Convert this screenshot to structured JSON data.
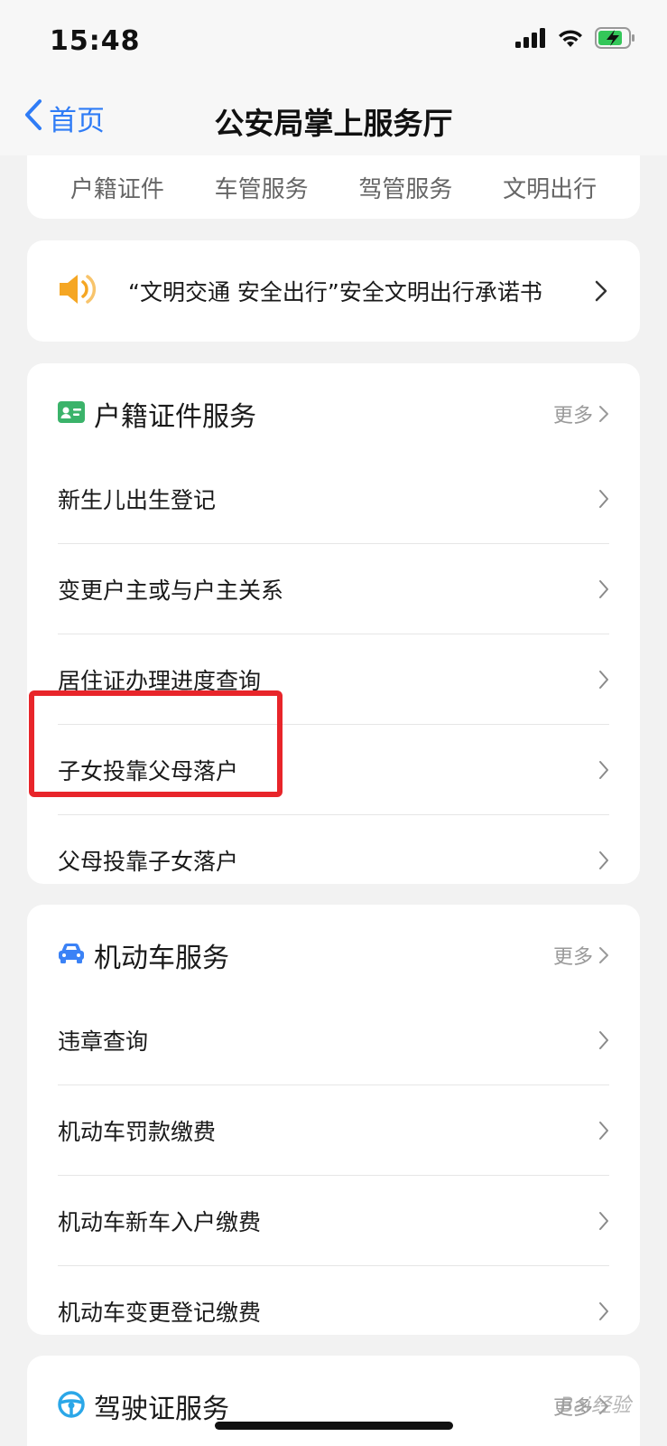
{
  "status_bar": {
    "time": "15:48",
    "icons": [
      "signal-icon",
      "wifi-icon",
      "battery-charging-icon"
    ]
  },
  "nav": {
    "back_label": "首页",
    "title": "公安局掌上服务厅"
  },
  "tabs": [
    {
      "label": "户籍证件"
    },
    {
      "label": "车管服务"
    },
    {
      "label": "驾管服务"
    },
    {
      "label": "文明出行"
    }
  ],
  "notice": {
    "icon": "speaker-icon",
    "text": "“文明交通 安全出行”安全文明出行承诺书"
  },
  "household": {
    "title": "户籍证件服务",
    "more": "更多",
    "items": [
      {
        "label": "新生儿出生登记"
      },
      {
        "label": "变更户主或与户主关系"
      },
      {
        "label": "居住证办理进度查询"
      },
      {
        "label": "子女投靠父母落户"
      },
      {
        "label": "父母投靠子女落户"
      }
    ]
  },
  "vehicle": {
    "title": "机动车服务",
    "more": "更多",
    "items": [
      {
        "label": "违章查询"
      },
      {
        "label": "机动车罚款缴费"
      },
      {
        "label": "机动车新车入户缴费"
      },
      {
        "label": "机动车变更登记缴费"
      }
    ]
  },
  "license": {
    "title": "驾驶证服务",
    "more": "更多"
  },
  "colors": {
    "accent": "#2f7cf6",
    "highlight": "#e8252a",
    "household_icon": "#3bb36a",
    "vehicle_icon": "#3b82f6",
    "license_icon": "#2ba7e8",
    "speaker": "#f5a623"
  },
  "watermark": "Bai经验"
}
